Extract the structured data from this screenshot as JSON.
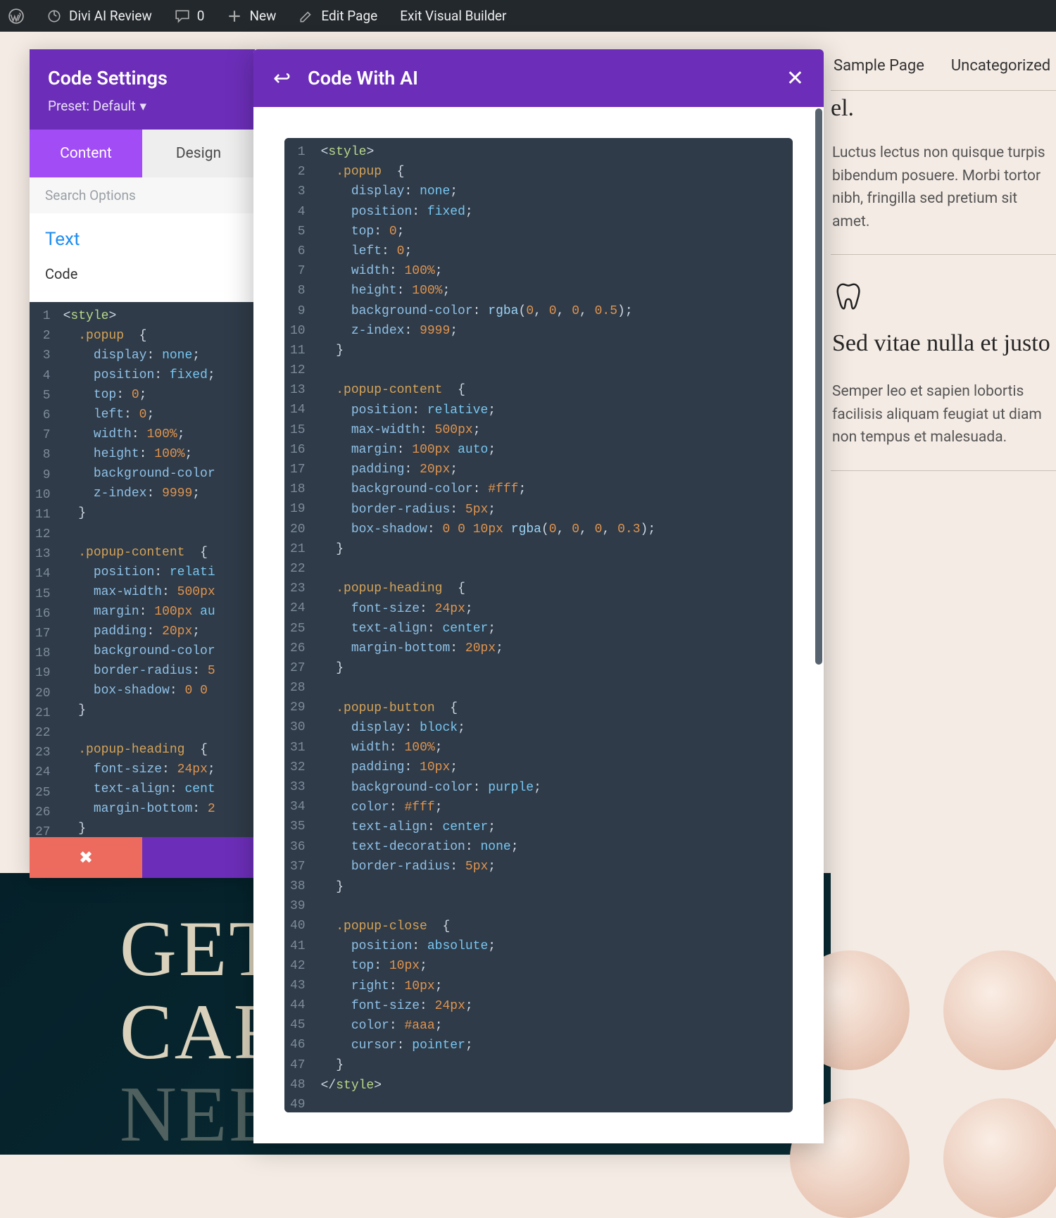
{
  "wp_bar": {
    "site_title": "Divi AI Review",
    "comments": "0",
    "new_label": "New",
    "edit_page": "Edit Page",
    "exit_vb": "Exit Visual Builder"
  },
  "top_nav": {
    "item1": "Sample Page",
    "item2": "Uncategorized"
  },
  "widget1": {
    "body": "Luctus lectus non quisque turpis bibendum posuere. Morbi tortor nibh, fringilla sed pretium sit amet."
  },
  "widget2": {
    "title": "Sed vitae nulla et justo",
    "body": "Semper leo et sapien lobortis facilisis aliquam feugiat ut diam non tempus et malesuada."
  },
  "hero": {
    "line1": "GET",
    "line2": "CAR",
    "line3": "NEED"
  },
  "settings": {
    "title": "Code Settings",
    "preset": "Preset: Default",
    "tab_content": "Content",
    "tab_design": "Design",
    "search_placeholder": "Search Options",
    "section_text": "Text",
    "field_code": "Code"
  },
  "ai_panel": {
    "title": "Code With AI"
  },
  "code_lines_left": [
    {
      "n": "1",
      "html": "<span class='tk-punc'>&lt;</span><span class='tk-name'>style</span><span class='tk-punc'>&gt;</span>"
    },
    {
      "n": "2",
      "html": "  <span class='tk-sel'>.popup</span>  <span class='tk-punc'>{</span>"
    },
    {
      "n": "3",
      "html": "    <span class='tk-prop'>display</span><span class='tk-punc'>:</span> <span class='tk-kw'>none</span><span class='tk-punc'>;</span>"
    },
    {
      "n": "4",
      "html": "    <span class='tk-prop'>position</span><span class='tk-punc'>:</span> <span class='tk-kw'>fixed</span><span class='tk-punc'>;</span>"
    },
    {
      "n": "5",
      "html": "    <span class='tk-prop'>top</span><span class='tk-punc'>:</span> <span class='tk-num'>0</span><span class='tk-punc'>;</span>"
    },
    {
      "n": "6",
      "html": "    <span class='tk-prop'>left</span><span class='tk-punc'>:</span> <span class='tk-num'>0</span><span class='tk-punc'>;</span>"
    },
    {
      "n": "7",
      "html": "    <span class='tk-prop'>width</span><span class='tk-punc'>:</span> <span class='tk-num'>100%</span><span class='tk-punc'>;</span>"
    },
    {
      "n": "8",
      "html": "    <span class='tk-prop'>height</span><span class='tk-punc'>:</span> <span class='tk-num'>100%</span><span class='tk-punc'>;</span>"
    },
    {
      "n": "9",
      "html": "    <span class='tk-prop'>background-color</span>"
    },
    {
      "n": "10",
      "html": "    <span class='tk-prop'>z-index</span><span class='tk-punc'>:</span> <span class='tk-num'>9999</span><span class='tk-punc'>;</span>"
    },
    {
      "n": "11",
      "html": "  <span class='tk-punc'>}</span>"
    },
    {
      "n": "12",
      "html": ""
    },
    {
      "n": "13",
      "html": "  <span class='tk-sel'>.popup-content</span>  <span class='tk-punc'>{</span>"
    },
    {
      "n": "14",
      "html": "    <span class='tk-prop'>position</span><span class='tk-punc'>:</span> <span class='tk-kw'>relati</span>"
    },
    {
      "n": "15",
      "html": "    <span class='tk-prop'>max-width</span><span class='tk-punc'>:</span> <span class='tk-num'>500px</span>"
    },
    {
      "n": "16",
      "html": "    <span class='tk-prop'>margin</span><span class='tk-punc'>:</span> <span class='tk-num'>100px</span> <span class='tk-kw'>au</span>"
    },
    {
      "n": "17",
      "html": "    <span class='tk-prop'>padding</span><span class='tk-punc'>:</span> <span class='tk-num'>20px</span><span class='tk-punc'>;</span>"
    },
    {
      "n": "18",
      "html": "    <span class='tk-prop'>background-color</span>"
    },
    {
      "n": "19",
      "html": "    <span class='tk-prop'>border-radius</span><span class='tk-punc'>:</span> <span class='tk-num'>5</span>"
    },
    {
      "n": "20",
      "html": "    <span class='tk-prop'>box-shadow</span><span class='tk-punc'>:</span> <span class='tk-num'>0</span> <span class='tk-num'>0</span>"
    },
    {
      "n": "21",
      "html": "  <span class='tk-punc'>}</span>"
    },
    {
      "n": "22",
      "html": ""
    },
    {
      "n": "23",
      "html": "  <span class='tk-sel'>.popup-heading</span>  <span class='tk-punc'>{</span>"
    },
    {
      "n": "24",
      "html": "    <span class='tk-prop'>font-size</span><span class='tk-punc'>:</span> <span class='tk-num'>24px</span><span class='tk-punc'>;</span>"
    },
    {
      "n": "25",
      "html": "    <span class='tk-prop'>text-align</span><span class='tk-punc'>:</span> <span class='tk-kw'>cent</span>"
    },
    {
      "n": "26",
      "html": "    <span class='tk-prop'>margin-bottom</span><span class='tk-punc'>:</span> <span class='tk-num'>2</span>"
    },
    {
      "n": "27",
      "html": "  <span class='tk-punc'>}</span>"
    }
  ],
  "code_lines_ai": [
    {
      "n": "1",
      "html": "<span class='tk-punc'>&lt;</span><span class='tk-name'>style</span><span class='tk-punc'>&gt;</span>"
    },
    {
      "n": "2",
      "html": "  <span class='tk-sel'>.popup</span>  <span class='tk-punc'>{</span>"
    },
    {
      "n": "3",
      "html": "    <span class='tk-prop'>display</span><span class='tk-punc'>:</span> <span class='tk-kw'>none</span><span class='tk-punc'>;</span>"
    },
    {
      "n": "4",
      "html": "    <span class='tk-prop'>position</span><span class='tk-punc'>:</span> <span class='tk-kw'>fixed</span><span class='tk-punc'>;</span>"
    },
    {
      "n": "5",
      "html": "    <span class='tk-prop'>top</span><span class='tk-punc'>:</span> <span class='tk-num'>0</span><span class='tk-punc'>;</span>"
    },
    {
      "n": "6",
      "html": "    <span class='tk-prop'>left</span><span class='tk-punc'>:</span> <span class='tk-num'>0</span><span class='tk-punc'>;</span>"
    },
    {
      "n": "7",
      "html": "    <span class='tk-prop'>width</span><span class='tk-punc'>:</span> <span class='tk-num'>100%</span><span class='tk-punc'>;</span>"
    },
    {
      "n": "8",
      "html": "    <span class='tk-prop'>height</span><span class='tk-punc'>:</span> <span class='tk-num'>100%</span><span class='tk-punc'>;</span>"
    },
    {
      "n": "9",
      "html": "    <span class='tk-prop'>background-color</span><span class='tk-punc'>:</span> <span class='tk-fn'>rgba</span><span class='tk-punc'>(</span><span class='tk-num'>0</span><span class='tk-punc'>,</span> <span class='tk-num'>0</span><span class='tk-punc'>,</span> <span class='tk-num'>0</span><span class='tk-punc'>,</span> <span class='tk-num'>0.5</span><span class='tk-punc'>);</span>"
    },
    {
      "n": "10",
      "html": "    <span class='tk-prop'>z-index</span><span class='tk-punc'>:</span> <span class='tk-num'>9999</span><span class='tk-punc'>;</span>"
    },
    {
      "n": "11",
      "html": "  <span class='tk-punc'>}</span>"
    },
    {
      "n": "12",
      "html": ""
    },
    {
      "n": "13",
      "html": "  <span class='tk-sel'>.popup-content</span>  <span class='tk-punc'>{</span>"
    },
    {
      "n": "14",
      "html": "    <span class='tk-prop'>position</span><span class='tk-punc'>:</span> <span class='tk-kw'>relative</span><span class='tk-punc'>;</span>"
    },
    {
      "n": "15",
      "html": "    <span class='tk-prop'>max-width</span><span class='tk-punc'>:</span> <span class='tk-num'>500px</span><span class='tk-punc'>;</span>"
    },
    {
      "n": "16",
      "html": "    <span class='tk-prop'>margin</span><span class='tk-punc'>:</span> <span class='tk-num'>100px</span> <span class='tk-kw'>auto</span><span class='tk-punc'>;</span>"
    },
    {
      "n": "17",
      "html": "    <span class='tk-prop'>padding</span><span class='tk-punc'>:</span> <span class='tk-num'>20px</span><span class='tk-punc'>;</span>"
    },
    {
      "n": "18",
      "html": "    <span class='tk-prop'>background-color</span><span class='tk-punc'>:</span> <span class='tk-num'>#fff</span><span class='tk-punc'>;</span>"
    },
    {
      "n": "19",
      "html": "    <span class='tk-prop'>border-radius</span><span class='tk-punc'>:</span> <span class='tk-num'>5px</span><span class='tk-punc'>;</span>"
    },
    {
      "n": "20",
      "html": "    <span class='tk-prop'>box-shadow</span><span class='tk-punc'>:</span> <span class='tk-num'>0</span> <span class='tk-num'>0</span> <span class='tk-num'>10px</span> <span class='tk-fn'>rgba</span><span class='tk-punc'>(</span><span class='tk-num'>0</span><span class='tk-punc'>,</span> <span class='tk-num'>0</span><span class='tk-punc'>,</span> <span class='tk-num'>0</span><span class='tk-punc'>,</span> <span class='tk-num'>0.3</span><span class='tk-punc'>);</span>"
    },
    {
      "n": "21",
      "html": "  <span class='tk-punc'>}</span>"
    },
    {
      "n": "22",
      "html": ""
    },
    {
      "n": "23",
      "html": "  <span class='tk-sel'>.popup-heading</span>  <span class='tk-punc'>{</span>"
    },
    {
      "n": "24",
      "html": "    <span class='tk-prop'>font-size</span><span class='tk-punc'>:</span> <span class='tk-num'>24px</span><span class='tk-punc'>;</span>"
    },
    {
      "n": "25",
      "html": "    <span class='tk-prop'>text-align</span><span class='tk-punc'>:</span> <span class='tk-kw'>center</span><span class='tk-punc'>;</span>"
    },
    {
      "n": "26",
      "html": "    <span class='tk-prop'>margin-bottom</span><span class='tk-punc'>:</span> <span class='tk-num'>20px</span><span class='tk-punc'>;</span>"
    },
    {
      "n": "27",
      "html": "  <span class='tk-punc'>}</span>"
    },
    {
      "n": "28",
      "html": ""
    },
    {
      "n": "29",
      "html": "  <span class='tk-sel'>.popup-button</span>  <span class='tk-punc'>{</span>"
    },
    {
      "n": "30",
      "html": "    <span class='tk-prop'>display</span><span class='tk-punc'>:</span> <span class='tk-kw'>block</span><span class='tk-punc'>;</span>"
    },
    {
      "n": "31",
      "html": "    <span class='tk-prop'>width</span><span class='tk-punc'>:</span> <span class='tk-num'>100%</span><span class='tk-punc'>;</span>"
    },
    {
      "n": "32",
      "html": "    <span class='tk-prop'>padding</span><span class='tk-punc'>:</span> <span class='tk-num'>10px</span><span class='tk-punc'>;</span>"
    },
    {
      "n": "33",
      "html": "    <span class='tk-prop'>background-color</span><span class='tk-punc'>:</span> <span class='tk-kw'>purple</span><span class='tk-punc'>;</span>"
    },
    {
      "n": "34",
      "html": "    <span class='tk-prop'>color</span><span class='tk-punc'>:</span> <span class='tk-num'>#fff</span><span class='tk-punc'>;</span>"
    },
    {
      "n": "35",
      "html": "    <span class='tk-prop'>text-align</span><span class='tk-punc'>:</span> <span class='tk-kw'>center</span><span class='tk-punc'>;</span>"
    },
    {
      "n": "36",
      "html": "    <span class='tk-prop'>text-decoration</span><span class='tk-punc'>:</span> <span class='tk-kw'>none</span><span class='tk-punc'>;</span>"
    },
    {
      "n": "37",
      "html": "    <span class='tk-prop'>border-radius</span><span class='tk-punc'>:</span> <span class='tk-num'>5px</span><span class='tk-punc'>;</span>"
    },
    {
      "n": "38",
      "html": "  <span class='tk-punc'>}</span>"
    },
    {
      "n": "39",
      "html": ""
    },
    {
      "n": "40",
      "html": "  <span class='tk-sel'>.popup-close</span>  <span class='tk-punc'>{</span>"
    },
    {
      "n": "41",
      "html": "    <span class='tk-prop'>position</span><span class='tk-punc'>:</span> <span class='tk-kw'>absolute</span><span class='tk-punc'>;</span>"
    },
    {
      "n": "42",
      "html": "    <span class='tk-prop'>top</span><span class='tk-punc'>:</span> <span class='tk-num'>10px</span><span class='tk-punc'>;</span>"
    },
    {
      "n": "43",
      "html": "    <span class='tk-prop'>right</span><span class='tk-punc'>:</span> <span class='tk-num'>10px</span><span class='tk-punc'>;</span>"
    },
    {
      "n": "44",
      "html": "    <span class='tk-prop'>font-size</span><span class='tk-punc'>:</span> <span class='tk-num'>24px</span><span class='tk-punc'>;</span>"
    },
    {
      "n": "45",
      "html": "    <span class='tk-prop'>color</span><span class='tk-punc'>:</span> <span class='tk-num'>#aaa</span><span class='tk-punc'>;</span>"
    },
    {
      "n": "46",
      "html": "    <span class='tk-prop'>cursor</span><span class='tk-punc'>:</span> <span class='tk-kw'>pointer</span><span class='tk-punc'>;</span>"
    },
    {
      "n": "47",
      "html": "  <span class='tk-punc'>}</span>"
    },
    {
      "n": "48",
      "html": "<span class='tk-punc'>&lt;/</span><span class='tk-name'>style</span><span class='tk-punc'>&gt;</span>"
    },
    {
      "n": "49",
      "html": ""
    }
  ]
}
